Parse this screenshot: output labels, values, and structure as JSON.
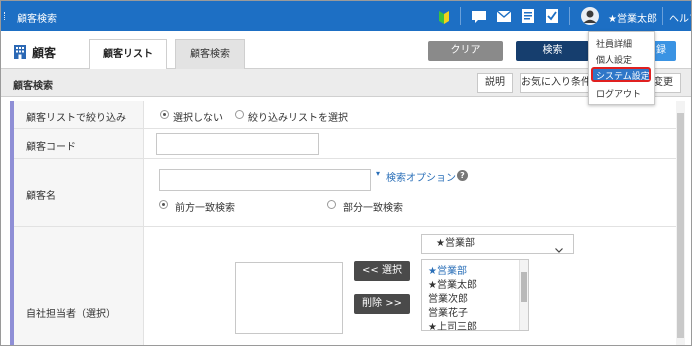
{
  "topbar": {
    "title": "顧客検索",
    "user_name": "★営業太郎",
    "help": "ヘルプ",
    "icons": [
      "beginner-mark-icon",
      "chat-icon",
      "mail-icon",
      "notes-icon",
      "check-icon",
      "user-avatar-icon"
    ],
    "colors": {
      "bar": "#1d6fc4"
    }
  },
  "header": {
    "module_title": "顧客",
    "tabs": [
      {
        "label": "顧客リスト",
        "active": true
      },
      {
        "label": "顧客検索",
        "active": false
      }
    ],
    "clear_label": "クリア",
    "search_label": "検索",
    "register_label": "録"
  },
  "section": {
    "title": "顧客検索",
    "desc_label": "説明",
    "favorite_label": "お気に入り条件",
    "change_label": "変更"
  },
  "user_menu": {
    "items": [
      "社員詳細",
      "個人設定",
      "システム設定",
      "ログアウト"
    ],
    "highlighted": "システム設定"
  },
  "form": {
    "filter": {
      "label": "顧客リストで絞り込み",
      "options": [
        "選択しない",
        "絞り込みリストを選択"
      ],
      "selected": "選択しない"
    },
    "code": {
      "label": "顧客コード",
      "value": ""
    },
    "name": {
      "label": "顧客名",
      "value": "",
      "search_option_link": "検索オプション",
      "match_options": [
        "前方一致検索",
        "部分一致検索"
      ],
      "selected": "前方一致検索"
    },
    "assignee": {
      "label": "自社担当者（選択）",
      "department_select": "★営業部",
      "select_button": "<< 選択",
      "remove_button": "削除 >>",
      "candidates": [
        "★営業部",
        "★営業太郎",
        "営業次郎",
        "営業花子",
        "★上司三郎"
      ],
      "highlighted": "★営業部"
    }
  }
}
